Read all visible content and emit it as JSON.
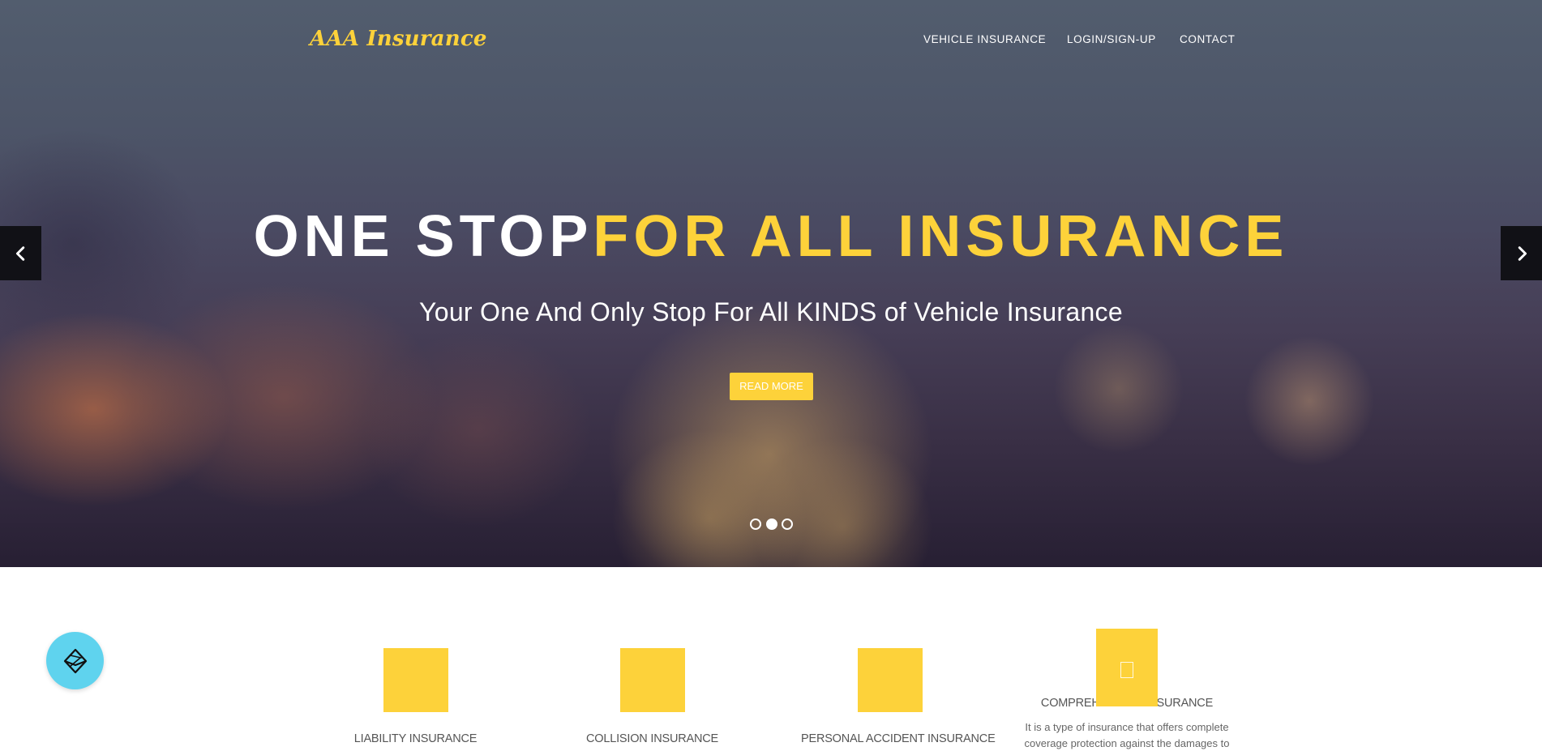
{
  "brand": {
    "logo_text": "AAA Insurance",
    "accent_color": "#fdd23a"
  },
  "nav": {
    "items": [
      {
        "label": "VEHICLE INSURANCE"
      },
      {
        "label": "LOGIN/SIGN-UP"
      },
      {
        "label": "CONTACT"
      }
    ]
  },
  "hero": {
    "headline_white": "ONE STOP",
    "headline_yellow": "FOR ALL INSURANCE",
    "subtitle": "Your One And Only Stop For All KINDS of Vehicle Insurance",
    "cta_label": "READ MORE",
    "prev_icon": "chevron-left-icon",
    "next_icon": "chevron-right-icon",
    "slides_total": 3,
    "active_slide": 2
  },
  "floating_button": {
    "icon": "cube-icon"
  },
  "features": [
    {
      "title": "LIABILITY INSURANCE",
      "desc": ""
    },
    {
      "title": "COLLISION INSURANCE",
      "desc": ""
    },
    {
      "title": "PERSONAL ACCIDENT INSURANCE",
      "desc": ""
    },
    {
      "title": "COMPREHENSIVE INSURANCE",
      "desc": "It is a type of insurance that offers complete coverage protection against the damages to"
    }
  ]
}
